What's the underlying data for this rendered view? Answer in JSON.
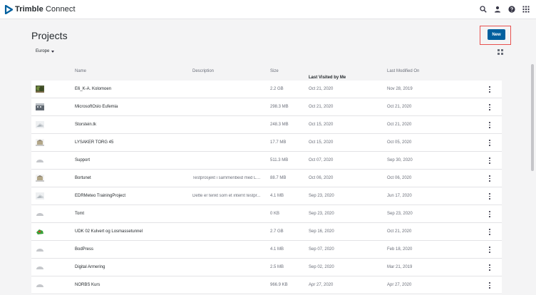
{
  "app": {
    "brand": "Trimble",
    "product": "Connect",
    "brand_color": "#005f9e"
  },
  "header_icons": [
    "search-icon",
    "user-icon",
    "help-icon",
    "apps-grid-icon"
  ],
  "page": {
    "title": "Projects",
    "region": "Europe",
    "new_button": "New"
  },
  "table": {
    "columns": {
      "name": "Name",
      "description": "Description",
      "size": "Size",
      "last_visited": "Last Visited by Me",
      "last_modified": "Last Modified On"
    },
    "sort_indicator": "↓",
    "rows": [
      {
        "name": "E6_K-A. Kolomoen",
        "description": "",
        "size": "2.2 GB",
        "last_visited": "Oct 21, 2020",
        "last_modified": "Nov 28, 2019",
        "thumbnail": "tree-photo"
      },
      {
        "name": "MicrosoftOslo Eufemia",
        "description": "",
        "size": "298.3 MB",
        "last_visited": "Oct 21, 2020",
        "last_modified": "Oct 21, 2020",
        "thumbnail": "building-photo"
      },
      {
        "name": "Storstein.tk",
        "description": "",
        "size": "248.3 MB",
        "last_visited": "Oct 15, 2020",
        "last_modified": "Oct 21, 2020",
        "thumbnail": "model-light"
      },
      {
        "name": "LYSAKER TORG 45",
        "description": "",
        "size": "17.7 MB",
        "last_visited": "Oct 15, 2020",
        "last_modified": "Oct 05, 2020",
        "thumbnail": "model-building"
      },
      {
        "name": "Support",
        "description": "",
        "size": "511.3 MB",
        "last_visited": "Oct 07, 2020",
        "last_modified": "Sep 30, 2020",
        "thumbnail": "placeholder-cloud"
      },
      {
        "name": "Bortunet",
        "description": "Testprosjekt i sammenbeid med Loe...",
        "size": "88.7 MB",
        "last_visited": "Oct 06, 2020",
        "last_modified": "Oct 06, 2020",
        "thumbnail": "model-building"
      },
      {
        "name": "EDRMeteo TrainingProject",
        "description": "Dette er tenkt som et internt testpr...",
        "size": "4.1 MB",
        "last_visited": "Sep 23, 2020",
        "last_modified": "Jun 17, 2020",
        "thumbnail": "model-light"
      },
      {
        "name": "Tomt",
        "description": "",
        "size": "0 KB",
        "last_visited": "Sep 23, 2020",
        "last_modified": "Sep 23, 2020",
        "thumbnail": "placeholder-cloud"
      },
      {
        "name": "UDK 02 Kulvert og Losmassetunnel",
        "description": "",
        "size": "2.7 GB",
        "last_visited": "Sep 16, 2020",
        "last_modified": "Oct 21, 2020",
        "thumbnail": "model-green"
      },
      {
        "name": "BodPress",
        "description": "",
        "size": "4.1 MB",
        "last_visited": "Sep 07, 2020",
        "last_modified": "Feb 18, 2020",
        "thumbnail": "placeholder-cloud"
      },
      {
        "name": "Digital Armering",
        "description": "",
        "size": "2.5 MB",
        "last_visited": "Sep 02, 2020",
        "last_modified": "Mar 21, 2019",
        "thumbnail": "placeholder-cloud"
      },
      {
        "name": "NORBS Kurs",
        "description": "",
        "size": "966.9 KB",
        "last_visited": "Apr 27, 2020",
        "last_modified": "Apr 27, 2020",
        "thumbnail": "placeholder-cloud"
      }
    ]
  },
  "colors": {
    "accent": "#005f9e",
    "highlight": "#e8514f",
    "background": "#f4f4f5"
  }
}
